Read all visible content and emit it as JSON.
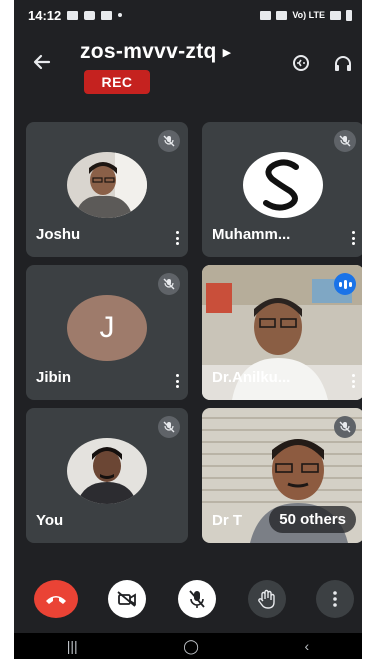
{
  "status": {
    "time": "14:12",
    "network": "Vo) LTE"
  },
  "header": {
    "title": "zos-mvvv-ztq",
    "rec_label": "REC"
  },
  "tiles": [
    {
      "name": "Joshu",
      "muted": true,
      "kind": "photo"
    },
    {
      "name": "Muhamm...",
      "muted": true,
      "kind": "logo",
      "logo_letter": "S"
    },
    {
      "name": "Jibin",
      "muted": true,
      "kind": "letter",
      "initial": "J"
    },
    {
      "name": "Dr.Anilku...",
      "muted": false,
      "kind": "video"
    },
    {
      "name": "You",
      "muted": true,
      "kind": "photo"
    },
    {
      "name": "Dr T",
      "muted": true,
      "kind": "video",
      "others": "50 others"
    }
  ],
  "colors": {
    "background": "#202124",
    "tile": "#3c4043",
    "end_call": "#ea4335",
    "rec": "#c5221f",
    "speaking": "#1a73e8"
  },
  "controls": [
    "end-call",
    "camera-off",
    "mic-off",
    "raise-hand",
    "more-options"
  ]
}
